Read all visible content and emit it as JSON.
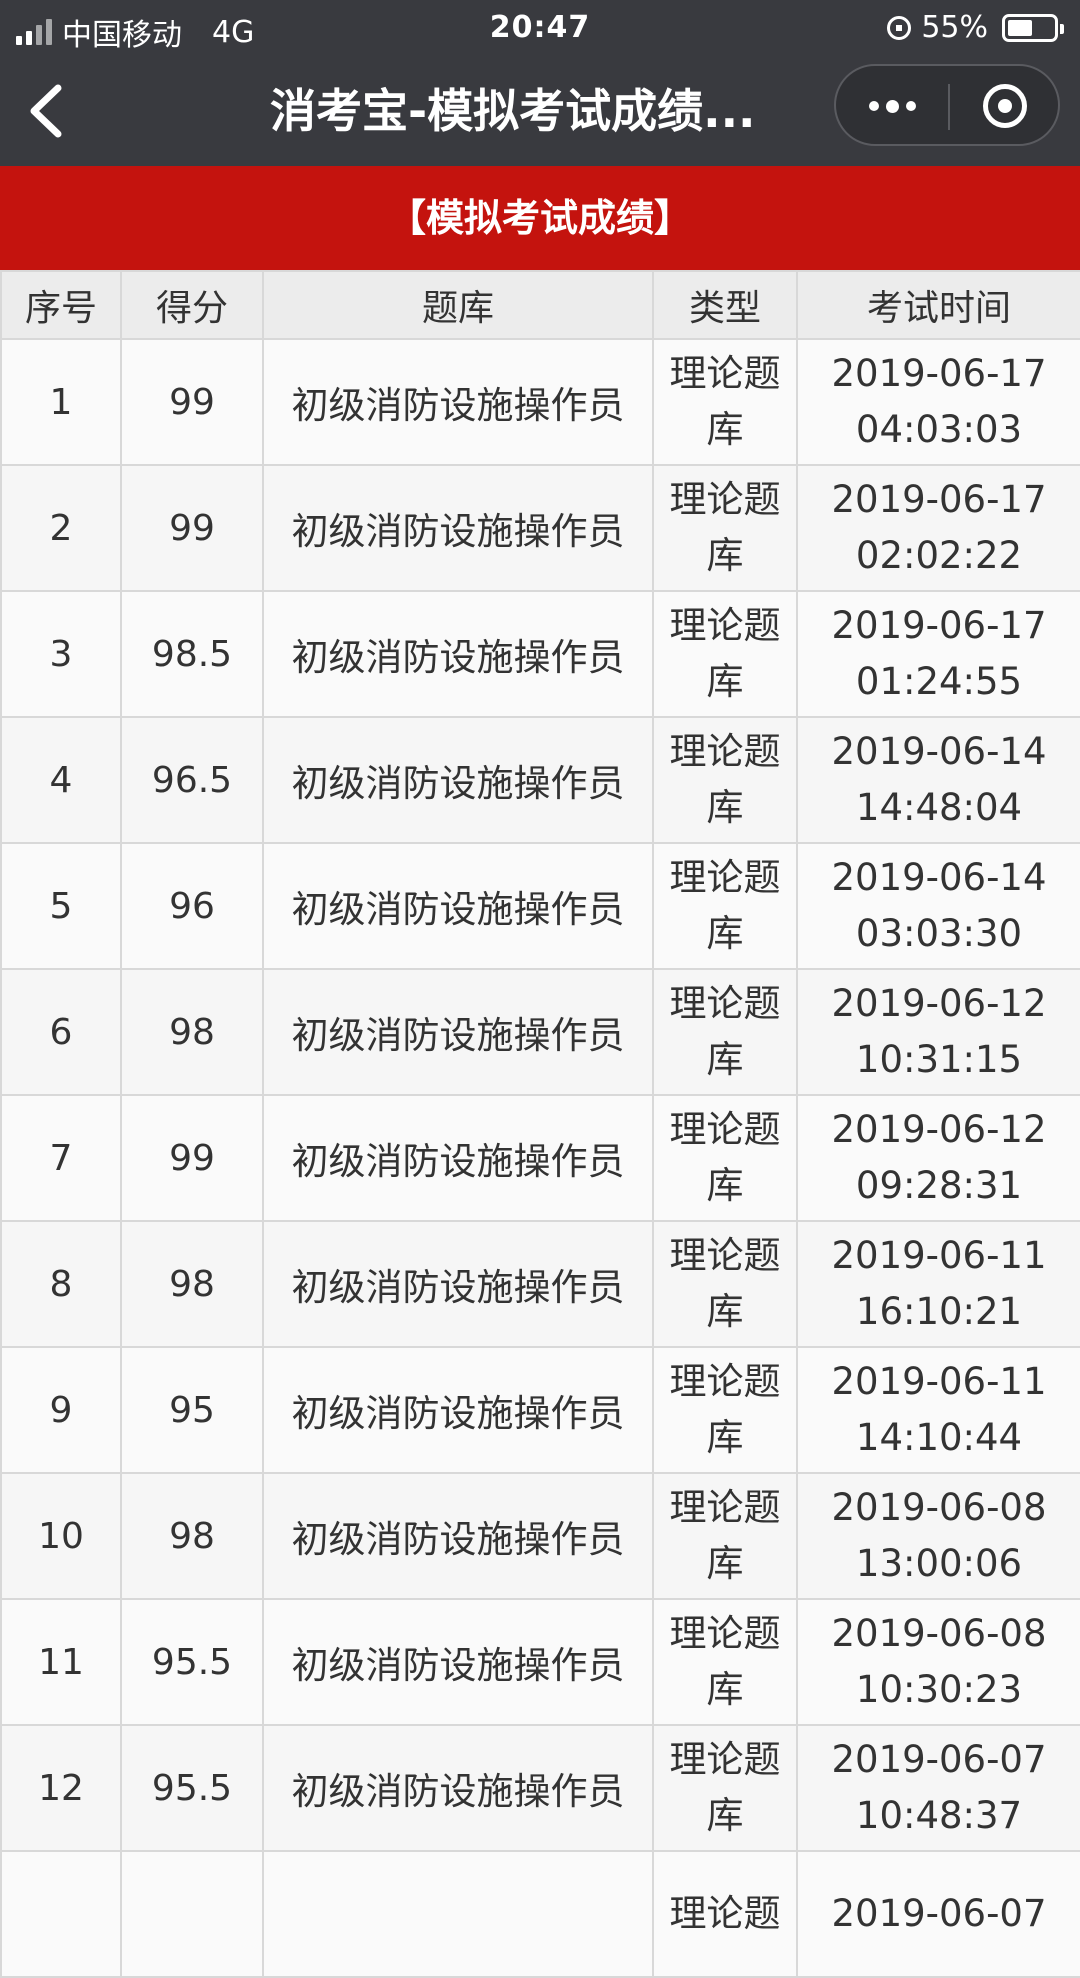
{
  "status_bar": {
    "carrier": "中国移动",
    "network": "4G",
    "time": "20:47",
    "battery": "55%",
    "battery_level": 0.55
  },
  "nav": {
    "title": "消考宝-模拟考试成绩..."
  },
  "banner": {
    "title": "【模拟考试成绩】"
  },
  "table": {
    "headers": [
      "序号",
      "得分",
      "题库",
      "类型",
      "考试时间"
    ],
    "rows": [
      {
        "no": "1",
        "score": "99",
        "bank": "初级消防设施操作员",
        "type": "理论题库",
        "date": "2019-06-17",
        "time": "04:03:03"
      },
      {
        "no": "2",
        "score": "99",
        "bank": "初级消防设施操作员",
        "type": "理论题库",
        "date": "2019-06-17",
        "time": "02:02:22"
      },
      {
        "no": "3",
        "score": "98.5",
        "bank": "初级消防设施操作员",
        "type": "理论题库",
        "date": "2019-06-17",
        "time": "01:24:55"
      },
      {
        "no": "4",
        "score": "96.5",
        "bank": "初级消防设施操作员",
        "type": "理论题库",
        "date": "2019-06-14",
        "time": "14:48:04"
      },
      {
        "no": "5",
        "score": "96",
        "bank": "初级消防设施操作员",
        "type": "理论题库",
        "date": "2019-06-14",
        "time": "03:03:30"
      },
      {
        "no": "6",
        "score": "98",
        "bank": "初级消防设施操作员",
        "type": "理论题库",
        "date": "2019-06-12",
        "time": "10:31:15"
      },
      {
        "no": "7",
        "score": "99",
        "bank": "初级消防设施操作员",
        "type": "理论题库",
        "date": "2019-06-12",
        "time": "09:28:31"
      },
      {
        "no": "8",
        "score": "98",
        "bank": "初级消防设施操作员",
        "type": "理论题库",
        "date": "2019-06-11",
        "time": "16:10:21"
      },
      {
        "no": "9",
        "score": "95",
        "bank": "初级消防设施操作员",
        "type": "理论题库",
        "date": "2019-06-11",
        "time": "14:10:44"
      },
      {
        "no": "10",
        "score": "98",
        "bank": "初级消防设施操作员",
        "type": "理论题库",
        "date": "2019-06-08",
        "time": "13:00:06"
      },
      {
        "no": "11",
        "score": "95.5",
        "bank": "初级消防设施操作员",
        "type": "理论题库",
        "date": "2019-06-08",
        "time": "10:30:23"
      },
      {
        "no": "12",
        "score": "95.5",
        "bank": "初级消防设施操作员",
        "type": "理论题库",
        "date": "2019-06-07",
        "time": "10:48:37"
      },
      {
        "no": "",
        "score": "",
        "bank": "",
        "type": "理论题",
        "date": "2019-06-07",
        "time": ""
      }
    ]
  },
  "colors": {
    "status_bg": "#393a3f",
    "banner_red": "#c4130e",
    "table_border": "#d8d8d8"
  },
  "icons": [
    "signal-icon",
    "rotation-lock-icon",
    "battery-icon",
    "back-chevron-icon",
    "more-dots-icon",
    "close-target-icon"
  ]
}
